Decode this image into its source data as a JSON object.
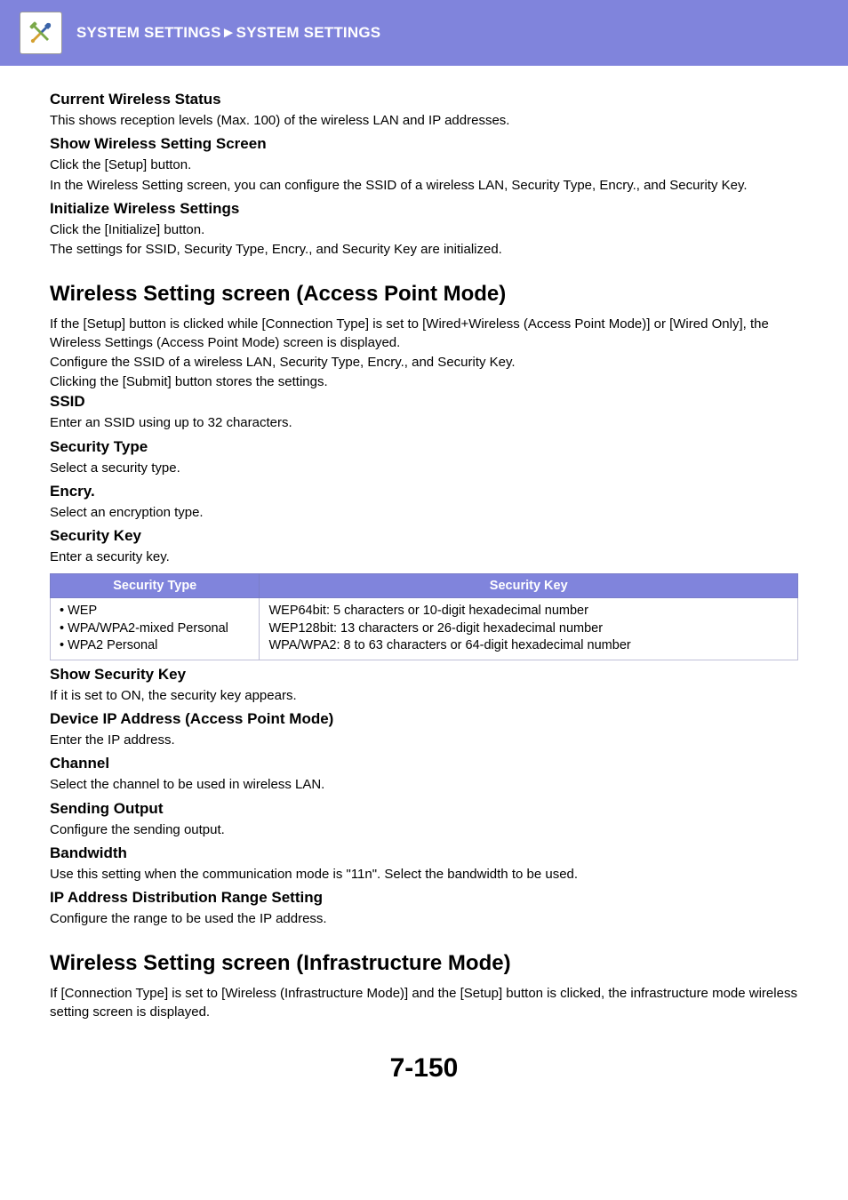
{
  "header": {
    "breadcrumb": "SYSTEM SETTINGS►SYSTEM SETTINGS"
  },
  "sections": {
    "cws": {
      "title": "Current Wireless Status",
      "body1": "This shows reception levels (Max. 100) of the wireless LAN and IP addresses."
    },
    "swss": {
      "title": "Show Wireless Setting Screen",
      "body1": "Click the [Setup] button.",
      "body2": "In the Wireless Setting screen, you can configure the SSID of a wireless LAN, Security Type, Encry., and Security Key."
    },
    "iws": {
      "title": "Initialize Wireless Settings",
      "body1": "Click the [Initialize] button.",
      "body2": "The settings for SSID, Security Type, Encry., and Security Key are initialized."
    },
    "wssap": {
      "title": "Wireless Setting screen (Access Point Mode)",
      "body1": "If the [Setup] button is clicked while [Connection Type] is set to [Wired+Wireless (Access Point Mode)] or [Wired Only], the Wireless Settings (Access Point Mode) screen is displayed.",
      "body2": "Configure the SSID of a wireless LAN, Security Type, Encry., and Security Key.",
      "body3": "Clicking the [Submit] button stores the settings."
    },
    "ssid": {
      "title": "SSID",
      "body1": "Enter an SSID using up to 32 characters."
    },
    "sectype": {
      "title": "Security Type",
      "body1": "Select a security type."
    },
    "encry": {
      "title": "Encry.",
      "body1": "Select an encryption type."
    },
    "seckey": {
      "title": "Security Key",
      "body1": "Enter a security key."
    },
    "table": {
      "header_left": "Security Type",
      "header_right": "Security Key",
      "left1": "• WEP",
      "left2": "• WPA/WPA2-mixed Personal",
      "left3": "• WPA2 Personal",
      "right1": "WEP64bit: 5 characters or 10-digit hexadecimal number",
      "right2": "WEP128bit: 13 characters or 26-digit hexadecimal number",
      "right3": "WPA/WPA2: 8 to 63 characters or 64-digit hexadecimal number"
    },
    "ssk": {
      "title": "Show Security Key",
      "body1": "If it is set to ON, the security key appears."
    },
    "dip": {
      "title": "Device IP Address (Access Point Mode)",
      "body1": "Enter the IP address."
    },
    "channel": {
      "title": "Channel",
      "body1": "Select the channel to be used in wireless LAN."
    },
    "sout": {
      "title": "Sending Output",
      "body1": "Configure the sending output."
    },
    "bw": {
      "title": "Bandwidth",
      "body1": "Use this setting when the communication mode is \"11n\". Select the bandwidth to be used."
    },
    "ipdist": {
      "title": "IP Address Distribution Range Setting",
      "body1": "Configure the range to be used the IP address."
    },
    "wssim": {
      "title": "Wireless Setting screen (Infrastructure Mode)",
      "body1": "If [Connection Type] is set to [Wireless (Infrastructure Mode)] and the [Setup] button is clicked, the infrastructure mode wireless setting screen is displayed."
    }
  },
  "page_number": "7-150"
}
